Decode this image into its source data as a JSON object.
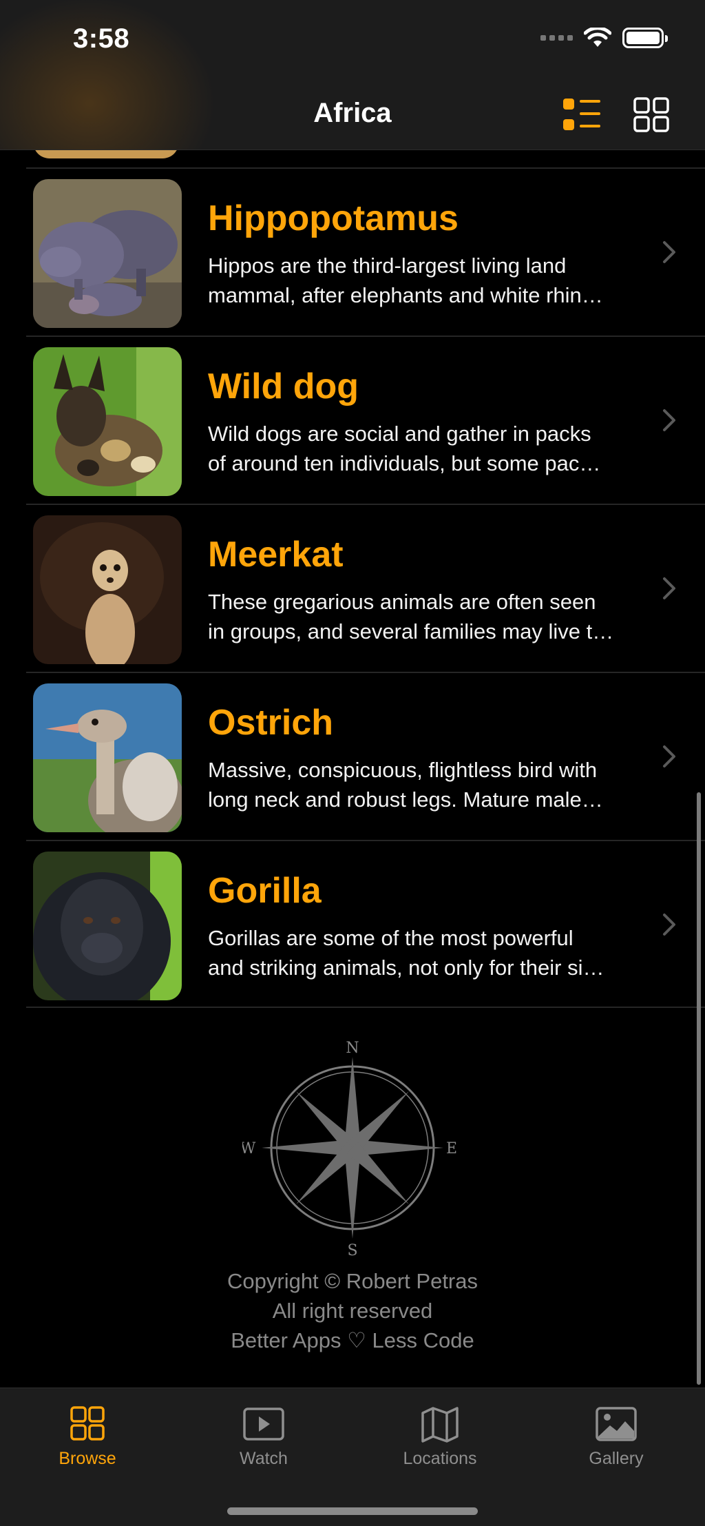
{
  "status_bar": {
    "time": "3:58"
  },
  "nav": {
    "title": "Africa",
    "list_view_icon": "list-view-icon",
    "grid_view_icon": "grid-view-icon",
    "accent_color": "#ffa50a"
  },
  "animals": [
    {
      "name": "Hippopotamus",
      "line1": "Hippos are the third-largest living land",
      "line2": "mammal, after elephants and white rhin…"
    },
    {
      "name": "Wild dog",
      "line1": "Wild dogs are social and gather in packs",
      "line2": "of around ten individuals, but some pac…"
    },
    {
      "name": "Meerkat",
      "line1": "These gregarious animals are often seen",
      "line2": "in groups, and several families may live t…"
    },
    {
      "name": "Ostrich",
      "line1": "Massive, conspicuous, flightless bird with",
      "line2": "long neck and robust legs. Mature male…"
    },
    {
      "name": "Gorilla",
      "line1": "Gorillas are some of the most powerful",
      "line2": "and striking animals, not only for their si…"
    }
  ],
  "compass": {
    "n": "N",
    "s": "S",
    "e": "E",
    "w": "W"
  },
  "footer": {
    "copyright": "Copyright © Robert Petras",
    "rights": "All right reserved",
    "tagline": "Better Apps ♡ Less Code"
  },
  "tabs": [
    {
      "label": "Browse",
      "icon": "grid-icon",
      "active": true
    },
    {
      "label": "Watch",
      "icon": "play-icon",
      "active": false
    },
    {
      "label": "Locations",
      "icon": "map-icon",
      "active": false
    },
    {
      "label": "Gallery",
      "icon": "photo-icon",
      "active": false
    }
  ]
}
